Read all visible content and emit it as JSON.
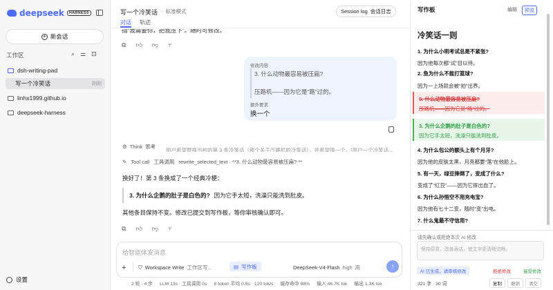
{
  "sidebar": {
    "logo": "deepseek",
    "logo_badge": "HARNESS",
    "new_chat": "新会话",
    "workspace_label": "工作区",
    "tools": [
      "⌕",
      "⚌",
      "⊡"
    ],
    "items": [
      {
        "label": "dsh-writing-pad"
      },
      {
        "label": "写一个冷笑话",
        "meta": "刚刚"
      },
      {
        "label": "linhx1999.github.io"
      },
      {
        "label": "deepseek-harness"
      }
    ],
    "settings": "设置"
  },
  "header": {
    "title": "写一个冷笑话",
    "mode": "标准模式",
    "tabs": [
      "对话",
      "轨迹"
    ],
    "session_log": "Session log",
    "session_log_cn": "会话日志"
  },
  "chat": {
    "cut_top": "指“我需要你，把我压下”。随时可修改。",
    "bubble": {
      "edit_label": "修改内容",
      "quote_line1": "3. 什么动物最容易被压扁?",
      "quote_line2": "压路机——因为它是“路”过的。",
      "req_label": "额外要求",
      "req_text": "换一个"
    },
    "think_label": "Think",
    "think_text": "思考",
    "think_cut": "用户希望替换当前的第 3 条冷笑话（那个关于压路机的冷笑话），并希望换一个。(用户一个冷笑话...",
    "tool_label": "Tool call",
    "tool_cn": "工具调用",
    "tool_text": "rewrite_selected_text · **3. 什么动物最容易被压扁? **",
    "resp1": "换好了！第 3 条换成了一个经典冷梗：",
    "resp_quote_bold": "3. 为什么企鹅的肚子是白色的?",
    "resp_quote_rest": "因为它手太短，洗澡只能洗到肚皮。",
    "resp2": "其他条目保持不变。修改已提交到写作板，等你审核确认即可。"
  },
  "input": {
    "placeholder": "给智能体发消息",
    "plus": "+",
    "workspace": "Workspace Write",
    "workspace_cn": "工作区写...",
    "pad": "写作板",
    "model": "DeepSeek-V4-Flash",
    "effort": "high",
    "effort_cn": "高",
    "send": "↑"
  },
  "status": {
    "turns": "2 轮 · 4 步",
    "llm": "LLM 13s · 工具调用 0s",
    "tokens": "8 token 平均 0.5s · 120 tok/s",
    "cache": "缓存命中 98%",
    "input": "输入 46.7K tok",
    "output": "输出 1.3K tok"
  },
  "pad": {
    "title": "写作板",
    "tab_edit": "编辑",
    "tab_preview": "预览",
    "doc_title": "冷笑话一则",
    "jokes": [
      {
        "q": "1. 为什么小明考试总是不紧张?",
        "a": "因为他每次都“试”目以待。"
      },
      {
        "q": "2. 鱼为什么不能打篮球?",
        "a": "因为一上场就会被“拍”出界。"
      },
      {
        "q": "3. 什么动物最容易被压扁?",
        "a": "压路机——因为它是“路”过的。"
      },
      {
        "q": "3. 为什么企鹅的肚子是白色的?",
        "a": "因为它手太短，洗澡只能洗到肚皮。"
      },
      {
        "q": "4. 为什么包公的额头上有个月牙?",
        "a": "因为他的皮肤太黑，月亮都要“落”在他脸上。"
      },
      {
        "q": "5. 有一天，绿豆摔倒了，变成了什么?",
        "a": "变成了“红豆”——因为它摔出血了。"
      },
      {
        "q": "6. 为什么孙悟空不用充电宝?",
        "a": "因为他有七十二变，随时“变”出电。"
      },
      {
        "q": "7. 什么鬼最不守信用?",
        "a": ""
      }
    ],
    "review_label": "请先确认或拒绝本次 AI 修改",
    "review_placeholder": "保持原意，改善表达，使文字更清晰流畅。",
    "ai_generated": "AI 已生成，请审核修改",
    "reject": "拒绝修改",
    "accept": "接受修改",
    "footer": "321 字 · 30 词",
    "copy": "复制",
    "undo": "撤销",
    "clear": "清空"
  },
  "colors": {
    "accent": "#4d6bfe",
    "deleted": "#d43c3c",
    "inserted": "#2e9d46"
  }
}
